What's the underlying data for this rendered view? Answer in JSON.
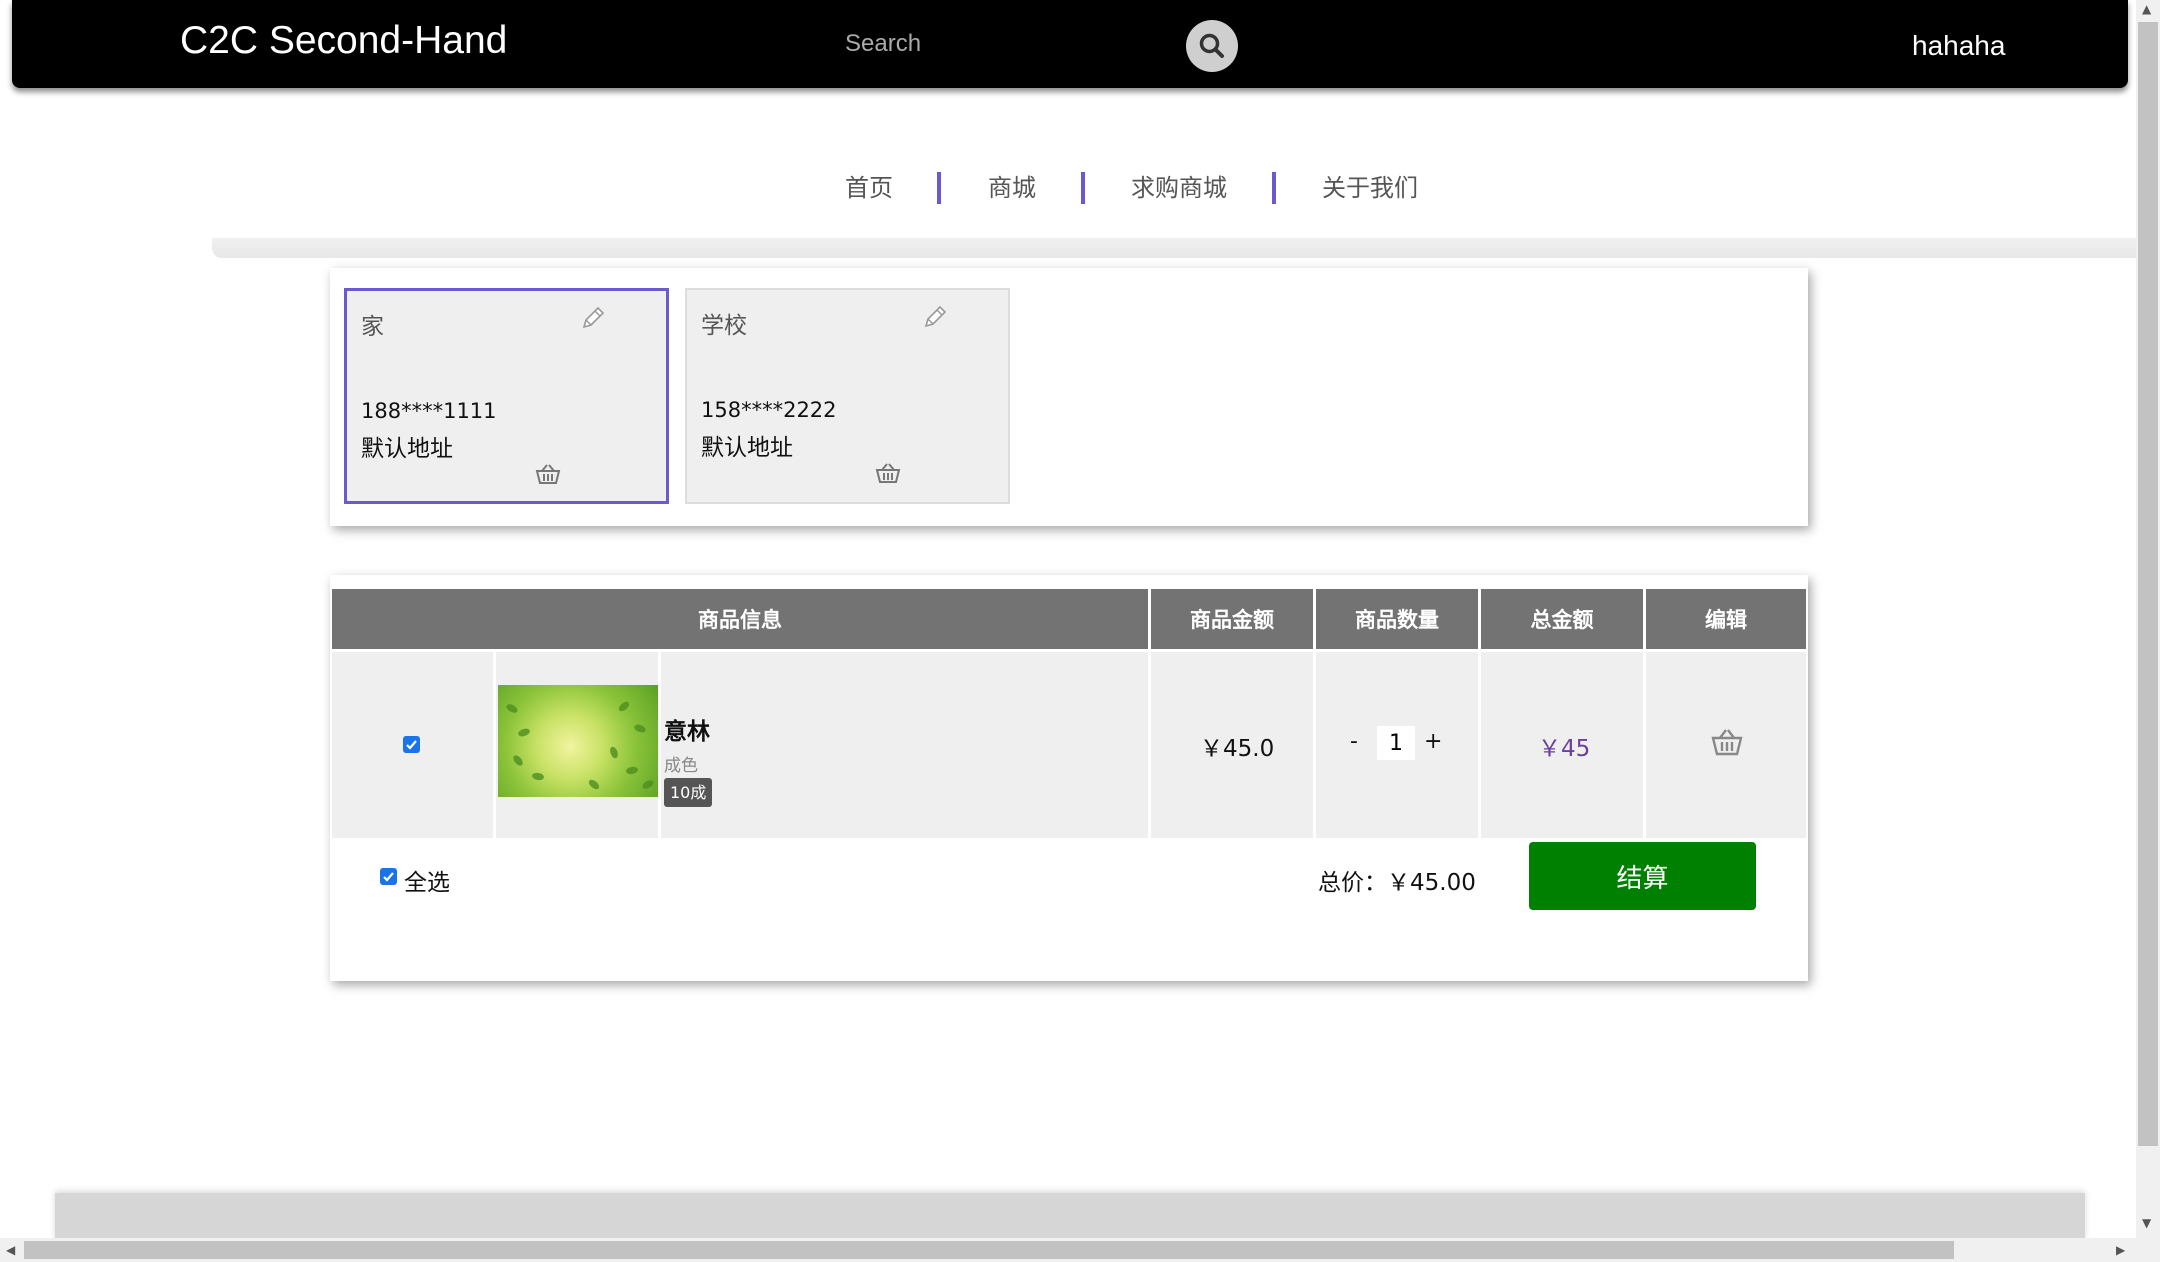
{
  "header": {
    "brand": "C2C Second-Hand",
    "search_placeholder": "Search",
    "username": "hahaha",
    "search_icon": "search-icon"
  },
  "nav": {
    "items": [
      {
        "label": "首页"
      },
      {
        "label": "商城"
      },
      {
        "label": "求购商城"
      },
      {
        "label": "关于我们"
      }
    ],
    "accent_color": "#6a5acd"
  },
  "addresses": [
    {
      "name": "家",
      "phone": "188****1111",
      "tag": "默认地址",
      "selected": true
    },
    {
      "name": "学校",
      "phone": "158****2222",
      "tag": "默认地址",
      "selected": false
    }
  ],
  "cart": {
    "headers": {
      "info": "商品信息",
      "price": "商品金额",
      "quantity": "商品数量",
      "total": "总金额",
      "edit": "编辑"
    },
    "items": [
      {
        "checked": true,
        "name": "意林",
        "condition_label": "成色",
        "condition": "10成",
        "price": "￥45.0",
        "quantity": "1",
        "qty_minus": "-",
        "qty_plus": "+",
        "total": "￥45"
      }
    ],
    "select_all_label": "全选",
    "select_all_checked": true,
    "sum_label": "总价：",
    "sum_value": "￥45.00",
    "checkout_label": "结算",
    "checkout_color": "#008000"
  }
}
